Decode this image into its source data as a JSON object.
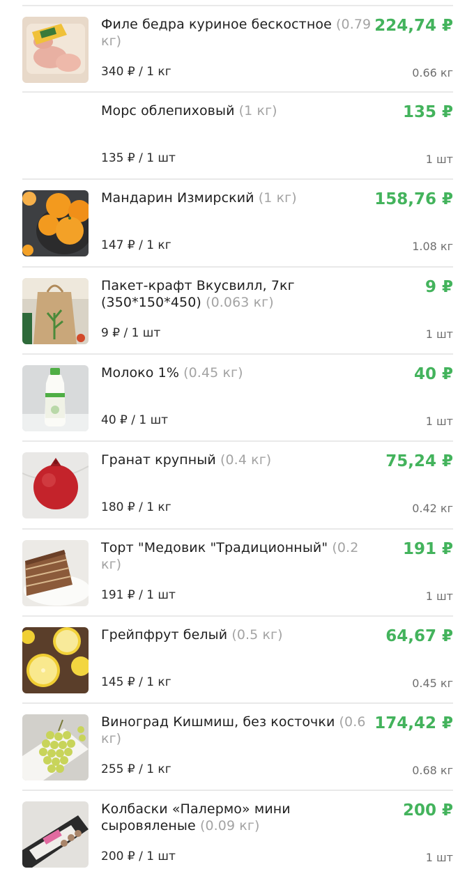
{
  "items": [
    {
      "name": "Филе бедра куриное бескостное",
      "weight": "(0.79 кг)",
      "price": "224,74 ₽",
      "unit_price": "340 ₽ / 1 кг",
      "qty": "0.66 кг",
      "image": "chicken-thigh-image"
    },
    {
      "name": "Морс облепиховый",
      "weight": "(1 кг)",
      "price": "135 ₽",
      "unit_price": "135 ₽ / 1 шт",
      "qty": "1 шт",
      "image": ""
    },
    {
      "name": "Мандарин Измирский",
      "weight": "(1 кг)",
      "price": "158,76 ₽",
      "unit_price": "147 ₽ / 1 кг",
      "qty": "1.08 кг",
      "image": "mandarin-image"
    },
    {
      "name": "Пакет-крафт Вкусвилл, 7кг (350*150*450)",
      "weight": "(0.063 кг)",
      "price": "9 ₽",
      "unit_price": "9 ₽ / 1 шт",
      "qty": "1 шт",
      "image": "kraft-bag-image"
    },
    {
      "name": "Молоко 1%",
      "weight": "(0.45 кг)",
      "price": "40 ₽",
      "unit_price": "40 ₽ / 1 шт",
      "qty": "1 шт",
      "image": "milk-bottle-image"
    },
    {
      "name": "Гранат крупный",
      "weight": "(0.4 кг)",
      "price": "75,24 ₽",
      "unit_price": "180 ₽ / 1 кг",
      "qty": "0.42 кг",
      "image": "pomegranate-image"
    },
    {
      "name": "Торт \"Медовик \"Традиционный\"",
      "weight": "(0.2 кг)",
      "price": "191 ₽",
      "unit_price": "191 ₽ / 1 шт",
      "qty": "1 шт",
      "image": "honey-cake-image"
    },
    {
      "name": "Грейпфрут белый",
      "weight": "(0.5 кг)",
      "price": "64,67 ₽",
      "unit_price": "145 ₽ / 1 кг",
      "qty": "0.45 кг",
      "image": "grapefruit-image"
    },
    {
      "name": "Виноград Кишмиш, без косточки",
      "weight": "(0.6 кг)",
      "price": "174,42 ₽",
      "unit_price": "255 ₽ / 1 кг",
      "qty": "0.68 кг",
      "image": "grapes-image"
    },
    {
      "name": "Колбаски «Палермо» мини сыровяленые",
      "weight": "(0.09 кг)",
      "price": "200 ₽",
      "unit_price": "200 ₽ / 1 шт",
      "qty": "1 шт",
      "image": "sausages-image"
    }
  ],
  "colors": {
    "price": "#43b35c",
    "divider": "#e9e9e9",
    "weight": "#a3a3a3"
  }
}
